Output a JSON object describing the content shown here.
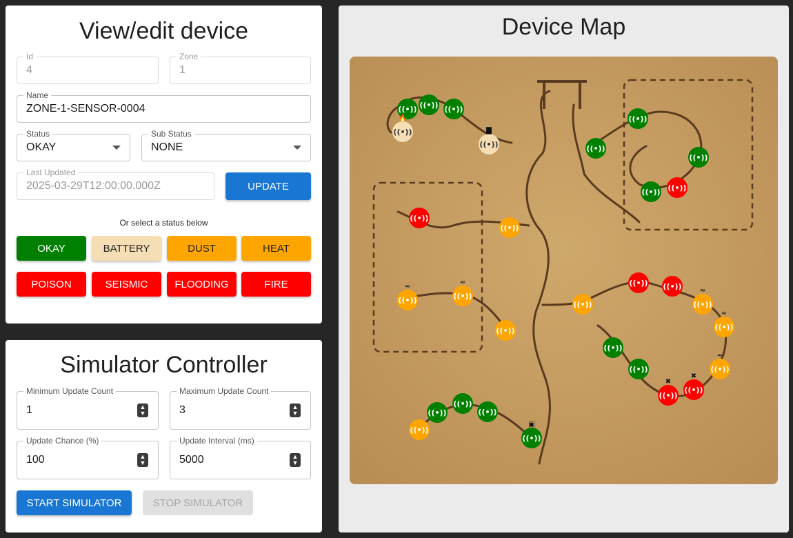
{
  "edit": {
    "title": "View/edit device",
    "id": {
      "label": "Id",
      "value": "4"
    },
    "zone": {
      "label": "Zone",
      "value": "1"
    },
    "name": {
      "label": "Name",
      "value": "ZONE-1-SENSOR-0004"
    },
    "status": {
      "label": "Status",
      "value": "OKAY"
    },
    "sub_status": {
      "label": "Sub Status",
      "value": "NONE"
    },
    "last_updated": {
      "label": "Last Updated",
      "value": "2025-03-29T12:00:00.000Z"
    },
    "update_label": "UPDATE",
    "hint": "Or select a status below",
    "status_buttons": [
      {
        "label": "OKAY",
        "color": "#008000",
        "text_color": "#ffffff"
      },
      {
        "label": "BATTERY",
        "color": "#f5deb3",
        "text_color": "#222222"
      },
      {
        "label": "DUST",
        "color": "#ffa500",
        "text_color": "#222222"
      },
      {
        "label": "HEAT",
        "color": "#ffa500",
        "text_color": "#222222"
      },
      {
        "label": "POISON",
        "color": "#ff0000",
        "text_color": "#ffffff"
      },
      {
        "label": "SEISMIC",
        "color": "#ff0000",
        "text_color": "#ffffff"
      },
      {
        "label": "FLOODING",
        "color": "#ff0000",
        "text_color": "#ffffff"
      },
      {
        "label": "FIRE",
        "color": "#ff0000",
        "text_color": "#ffffff"
      }
    ]
  },
  "sim": {
    "title": "Simulator Controller",
    "min_count": {
      "label": "Minimum Update Count",
      "value": "1"
    },
    "max_count": {
      "label": "Maximum Update Count",
      "value": "3"
    },
    "chance": {
      "label": "Update Chance (%)",
      "value": "100"
    },
    "interval": {
      "label": "Update Interval (ms)",
      "value": "5000"
    },
    "start_label": "START SIMULATOR",
    "stop_label": "STOP SIMULATOR"
  },
  "map": {
    "title": "Device Map",
    "colors": {
      "okay": "#008000",
      "battery": "#f5deb3",
      "warn": "#ffa500",
      "alarm": "#ff0000",
      "ground": "#c49b61",
      "ink": "#5a3b1f"
    },
    "devices": [
      {
        "status": "okay",
        "badge": ""
      },
      {
        "status": "okay",
        "badge": ""
      },
      {
        "status": "okay",
        "badge": ""
      },
      {
        "status": "battery",
        "badge": "fire-icon"
      },
      {
        "status": "battery",
        "badge": "battery-icon"
      },
      {
        "status": "okay",
        "badge": ""
      },
      {
        "status": "okay",
        "badge": ""
      },
      {
        "status": "okay",
        "badge": ""
      },
      {
        "status": "okay",
        "badge": ""
      },
      {
        "status": "alarm",
        "badge": ""
      },
      {
        "status": "alarm",
        "badge": ""
      },
      {
        "status": "warn",
        "badge": ""
      },
      {
        "status": "warn",
        "badge": "wind-icon"
      },
      {
        "status": "warn",
        "badge": "wind-icon"
      },
      {
        "status": "warn",
        "badge": ""
      },
      {
        "status": "warn",
        "badge": ""
      },
      {
        "status": "alarm",
        "badge": ""
      },
      {
        "status": "alarm",
        "badge": ""
      },
      {
        "status": "warn",
        "badge": "waves-icon"
      },
      {
        "status": "warn",
        "badge": "waves-icon"
      },
      {
        "status": "okay",
        "badge": ""
      },
      {
        "status": "okay",
        "badge": ""
      },
      {
        "status": "warn",
        "badge": "waves-icon"
      },
      {
        "status": "alarm",
        "badge": "skull-icon"
      },
      {
        "status": "alarm",
        "badge": "skull-icon"
      },
      {
        "status": "warn",
        "badge": ""
      },
      {
        "status": "okay",
        "badge": ""
      },
      {
        "status": "okay",
        "badge": ""
      },
      {
        "status": "okay",
        "badge": ""
      },
      {
        "status": "okay",
        "badge": "cart-icon"
      }
    ]
  }
}
